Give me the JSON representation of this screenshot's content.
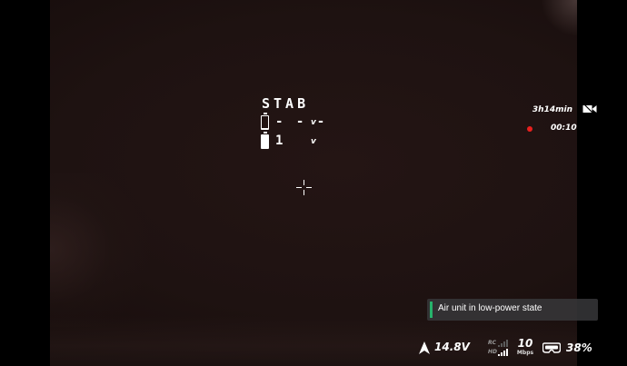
{
  "osd": {
    "flight_mode": "STAB",
    "battery": {
      "cell_voltage": "- - -",
      "cell_unit": "v",
      "pack_count": "1",
      "pack_unit": "v"
    },
    "flight_time_remaining": "3h14min",
    "recording": {
      "active": true,
      "elapsed": "00:10",
      "dot_color": "#e8201e"
    }
  },
  "notification": {
    "text": "Air unit in low-power state",
    "accent_color": "#27b36b"
  },
  "status_bar": {
    "voltage": "14.8V",
    "rc_label": "RC",
    "hd_label": "HD",
    "bitrate_value": "10",
    "bitrate_unit": "Mbps",
    "goggles_battery": "38%"
  },
  "icons": {
    "crosshair": "crosshair-icon",
    "camera": "camera-record-icon",
    "arrow": "navigation-arrow-icon",
    "signal": "signal-bars-icon",
    "goggles": "goggles-icon",
    "battery": "battery-icon"
  }
}
